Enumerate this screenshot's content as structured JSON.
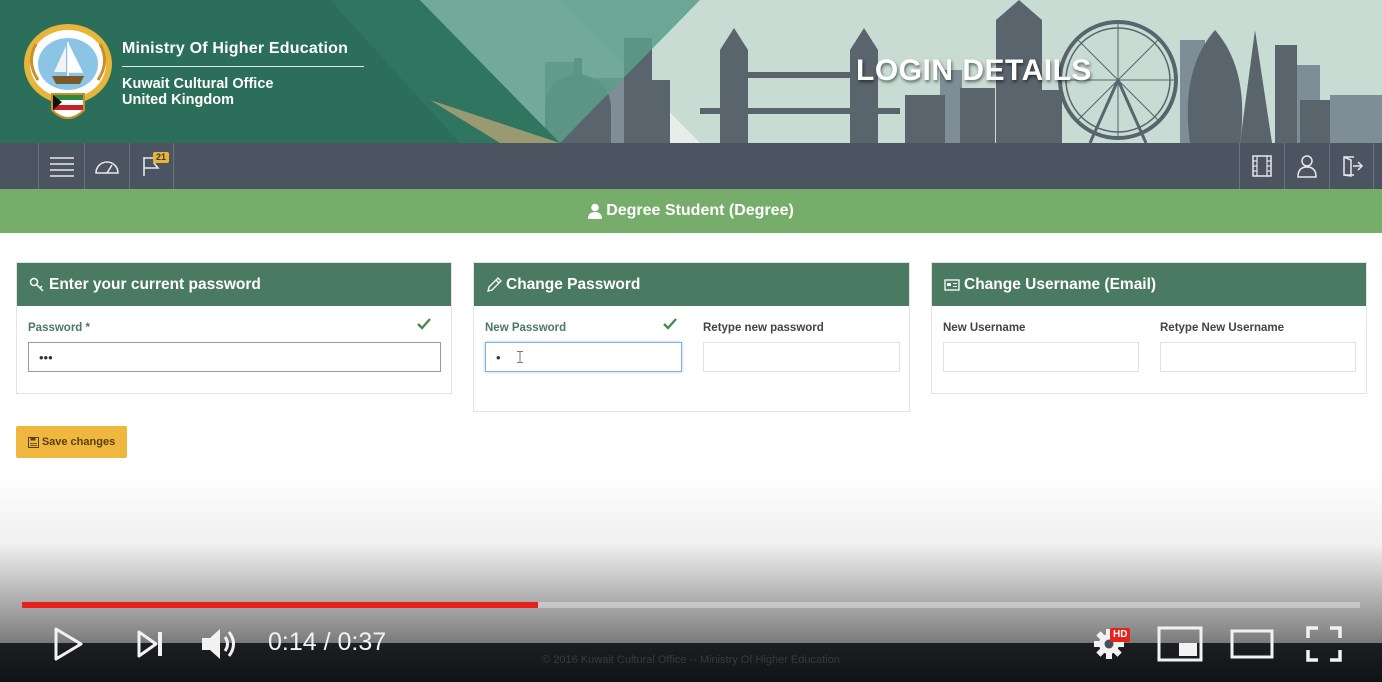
{
  "header": {
    "org_title": "Ministry Of Higher Education",
    "org_subtitle_line1": "Kuwait Cultural Office",
    "org_subtitle_line2": "United Kingdom",
    "page_heading": "LOGIN DETAILS"
  },
  "navbar": {
    "left_items": [
      {
        "icon": "menu-icon"
      },
      {
        "icon": "dashboard-gauge-icon"
      },
      {
        "icon": "flag-icon",
        "badge": "21"
      }
    ],
    "right_items": [
      {
        "icon": "film-icon"
      },
      {
        "icon": "user-icon"
      },
      {
        "icon": "logout-icon"
      }
    ]
  },
  "role_bar": {
    "icon": "user-icon",
    "label": "Degree Student (Degree)"
  },
  "panels": {
    "current_password": {
      "title": "Enter your current password",
      "icon": "key-icon",
      "password_label": "Password *",
      "password_value": "•••"
    },
    "change_password": {
      "title": "Change Password",
      "icon": "pencil-icon",
      "new_label": "New Password",
      "new_value": "•",
      "retype_label": "Retype new password",
      "retype_value": ""
    },
    "change_username": {
      "title": "Change Username (Email)",
      "icon": "id-card-icon",
      "new_label": "New Username",
      "new_value": "",
      "retype_label": "Retype New Username",
      "retype_value": ""
    }
  },
  "save_button": {
    "label": "Save changes",
    "icon": "save-icon"
  },
  "footer": {
    "text": "© 2016 Kuwait Cultural Office -- Ministry Of Higher Education"
  },
  "video_player": {
    "current_time": "0:14",
    "duration": "0:37",
    "time_display": "0:14 / 0:37",
    "progress": 0.386,
    "hd_badge": "HD"
  },
  "colors": {
    "navbar": "#4c5461",
    "role_bar": "#77ad6b",
    "panel_header": "#4a7a61",
    "save_button": "#efb73e",
    "progress": "#e8221a"
  }
}
